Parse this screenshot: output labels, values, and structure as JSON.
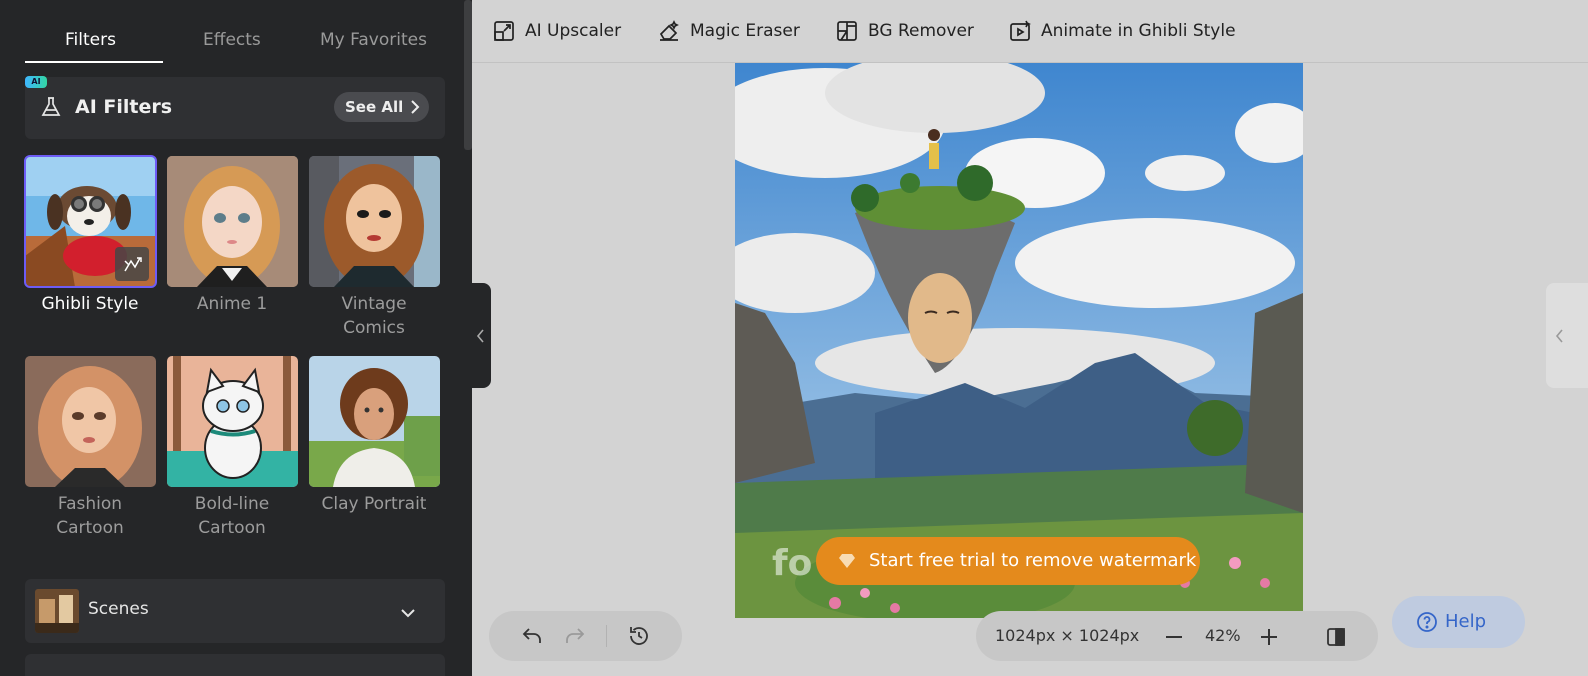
{
  "sidebar": {
    "tabs": [
      {
        "label": "Filters"
      },
      {
        "label": "Effects"
      },
      {
        "label": "My Favorites"
      }
    ],
    "ai_badge": "AI",
    "ai_filters_title": "AI Filters",
    "see_all": "See All",
    "filters": [
      {
        "label": "Ghibli Style",
        "selected": true
      },
      {
        "label": "Anime 1"
      },
      {
        "label": "Vintage Comics"
      },
      {
        "label": "Fashion Cartoon"
      },
      {
        "label": "Bold-line Cartoon"
      },
      {
        "label": "Clay Portrait"
      }
    ],
    "scenes_label": "Scenes"
  },
  "toolbar": {
    "tools": [
      {
        "label": "AI Upscaler",
        "icon": "upscale-icon"
      },
      {
        "label": "Magic Eraser",
        "icon": "eraser-icon"
      },
      {
        "label": "BG Remover",
        "icon": "bg-remove-icon"
      },
      {
        "label": "Animate in Ghibli Style",
        "icon": "animate-icon"
      }
    ]
  },
  "canvas": {
    "watermark_text": "fo",
    "trial_button": "Start free trial to remove watermark"
  },
  "bottom": {
    "dimensions": "1024px × 1024px",
    "zoom": "42%",
    "help": "Help"
  },
  "colors": {
    "accent": "#6d5cf6",
    "trial": "#e48a1c",
    "help_text": "#3566c9",
    "sidebar_bg": "#252628"
  }
}
